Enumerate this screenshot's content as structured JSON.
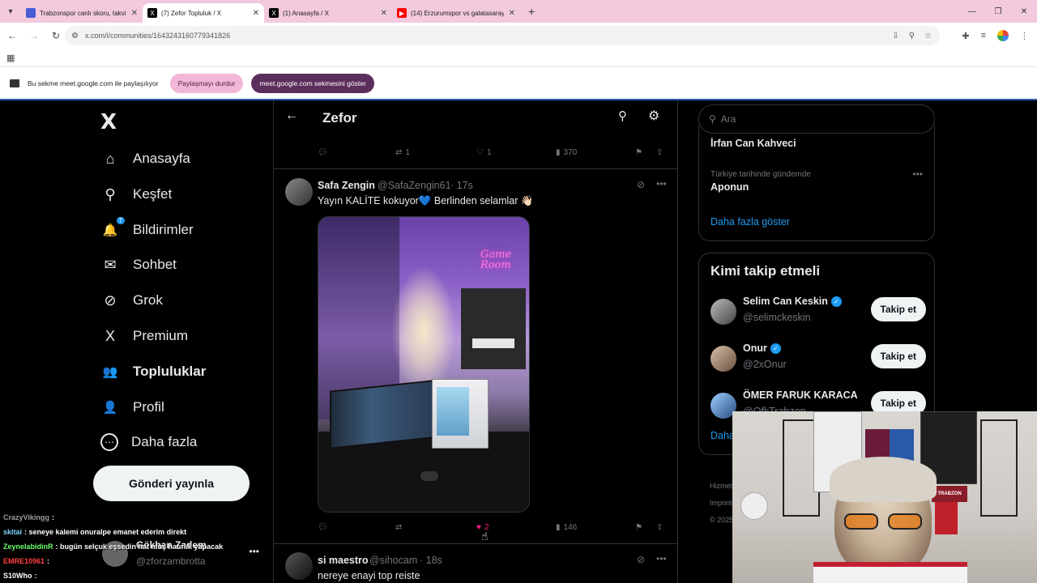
{
  "browser": {
    "tabs": [
      {
        "title": "Trabzonspor canlı skoru, takvim",
        "active": false,
        "favicon_color": "#4b5bd6"
      },
      {
        "title": "(7) Zefor Topluluk / X",
        "active": true,
        "favicon_color": "#000000"
      },
      {
        "title": "(1) Anasayfa / X",
        "active": false,
        "favicon_color": "#000000"
      },
      {
        "title": "(14) Erzurumspor vs galatasaray",
        "active": false,
        "favicon_color": "#ff0000"
      }
    ],
    "url": "x.com/i/communities/1643243160779341826",
    "share_bar": {
      "text": "Bu sekme meet.google.com ile paylaşılıyor",
      "stop_label": "Paylaşmayı durdur",
      "switch_label": "meet.google.com sekmesini göster"
    }
  },
  "sidebar": {
    "logo": "X",
    "items": [
      {
        "label": "Anasayfa",
        "icon": "home-icon",
        "glyph": "⌂"
      },
      {
        "label": "Keşfet",
        "icon": "search-icon",
        "glyph": "⚲"
      },
      {
        "label": "Bildirimler",
        "icon": "bell-icon",
        "glyph": "🔔",
        "badge": "7"
      },
      {
        "label": "Sohbet",
        "icon": "mail-icon",
        "glyph": "✉"
      },
      {
        "label": "Grok",
        "icon": "grok-icon",
        "glyph": "⊘"
      },
      {
        "label": "Premium",
        "icon": "x-premium-icon",
        "glyph": "X"
      },
      {
        "label": "Topluluklar",
        "icon": "communities-icon",
        "glyph": "👥",
        "active": true
      },
      {
        "label": "Profil",
        "icon": "profile-icon",
        "glyph": "👤"
      },
      {
        "label": "Daha fazla",
        "icon": "more-icon",
        "glyph": "⋯"
      }
    ],
    "post_button": "Gönderi yayınla",
    "account": {
      "name": "Gökhan Zadem",
      "handle": "@zforzambrotta"
    }
  },
  "chat": [
    {
      "user": "CrazyVikingg",
      "text": ":",
      "color": "#9b9b9b"
    },
    {
      "user": "skitai",
      "text": ": seneye kalemi onuralpe emanet ederim direkt",
      "color": "#7fd6ff"
    },
    {
      "user": "ZeynelabidinR",
      "text": ": bugün selçuk eşsedin hat muş hatırlık yapacak",
      "color": "#6cff6c"
    },
    {
      "user": "EMRE10961",
      "text": ":",
      "color": "#ff4040"
    },
    {
      "user": "S10Who",
      "text": ":",
      "color": "#ffffff"
    }
  ],
  "main": {
    "title": "Zefor",
    "top_actions": {
      "retweets": "1",
      "likes": "1",
      "views": "370"
    },
    "tweets": [
      {
        "name": "Safa Zengin",
        "handle": "@SafaZengin61",
        "time": "· 17s",
        "text": "Yayın KALİTE kokuyor💙 Berlinden selamlar 👋🏻",
        "photo_neon": "Game Room",
        "actions": {
          "replies": "",
          "retweets": "",
          "likes": "2",
          "views": "146"
        }
      },
      {
        "name": "si maestro",
        "handle": "@sihocam",
        "time": "· 18s",
        "text": "nereye enayi top reiste"
      }
    ]
  },
  "right": {
    "search_placeholder": "Ara",
    "trends": [
      {
        "name": "İrfan Can Kahveci",
        "context": ""
      },
      {
        "name": "Aponun",
        "context": "Türkiye tarihinde gündemde"
      }
    ],
    "show_more": "Daha fazla göster",
    "follow_title": "Kimi takip etmeli",
    "follow": [
      {
        "name": "Selim Can Keskin",
        "handle": "@selimckeskin",
        "verified": true,
        "button": "Takip et"
      },
      {
        "name": "Onur",
        "handle": "@2xOnur",
        "verified": true,
        "button": "Takip et"
      },
      {
        "name": "ÖMER FARUK KARACA",
        "handle": "@OfkTrabzon",
        "verified": false,
        "button": "Takip et"
      }
    ],
    "follow_more": "Daha fazla göster",
    "footer": [
      "Hizmet",
      "Imprint",
      "© 2025"
    ]
  },
  "webcam": {
    "sign": "TRABZON"
  },
  "colors": {
    "accent": "#1d9bf0",
    "like": "#f91880",
    "tabstrip": "#f2c9dd"
  }
}
